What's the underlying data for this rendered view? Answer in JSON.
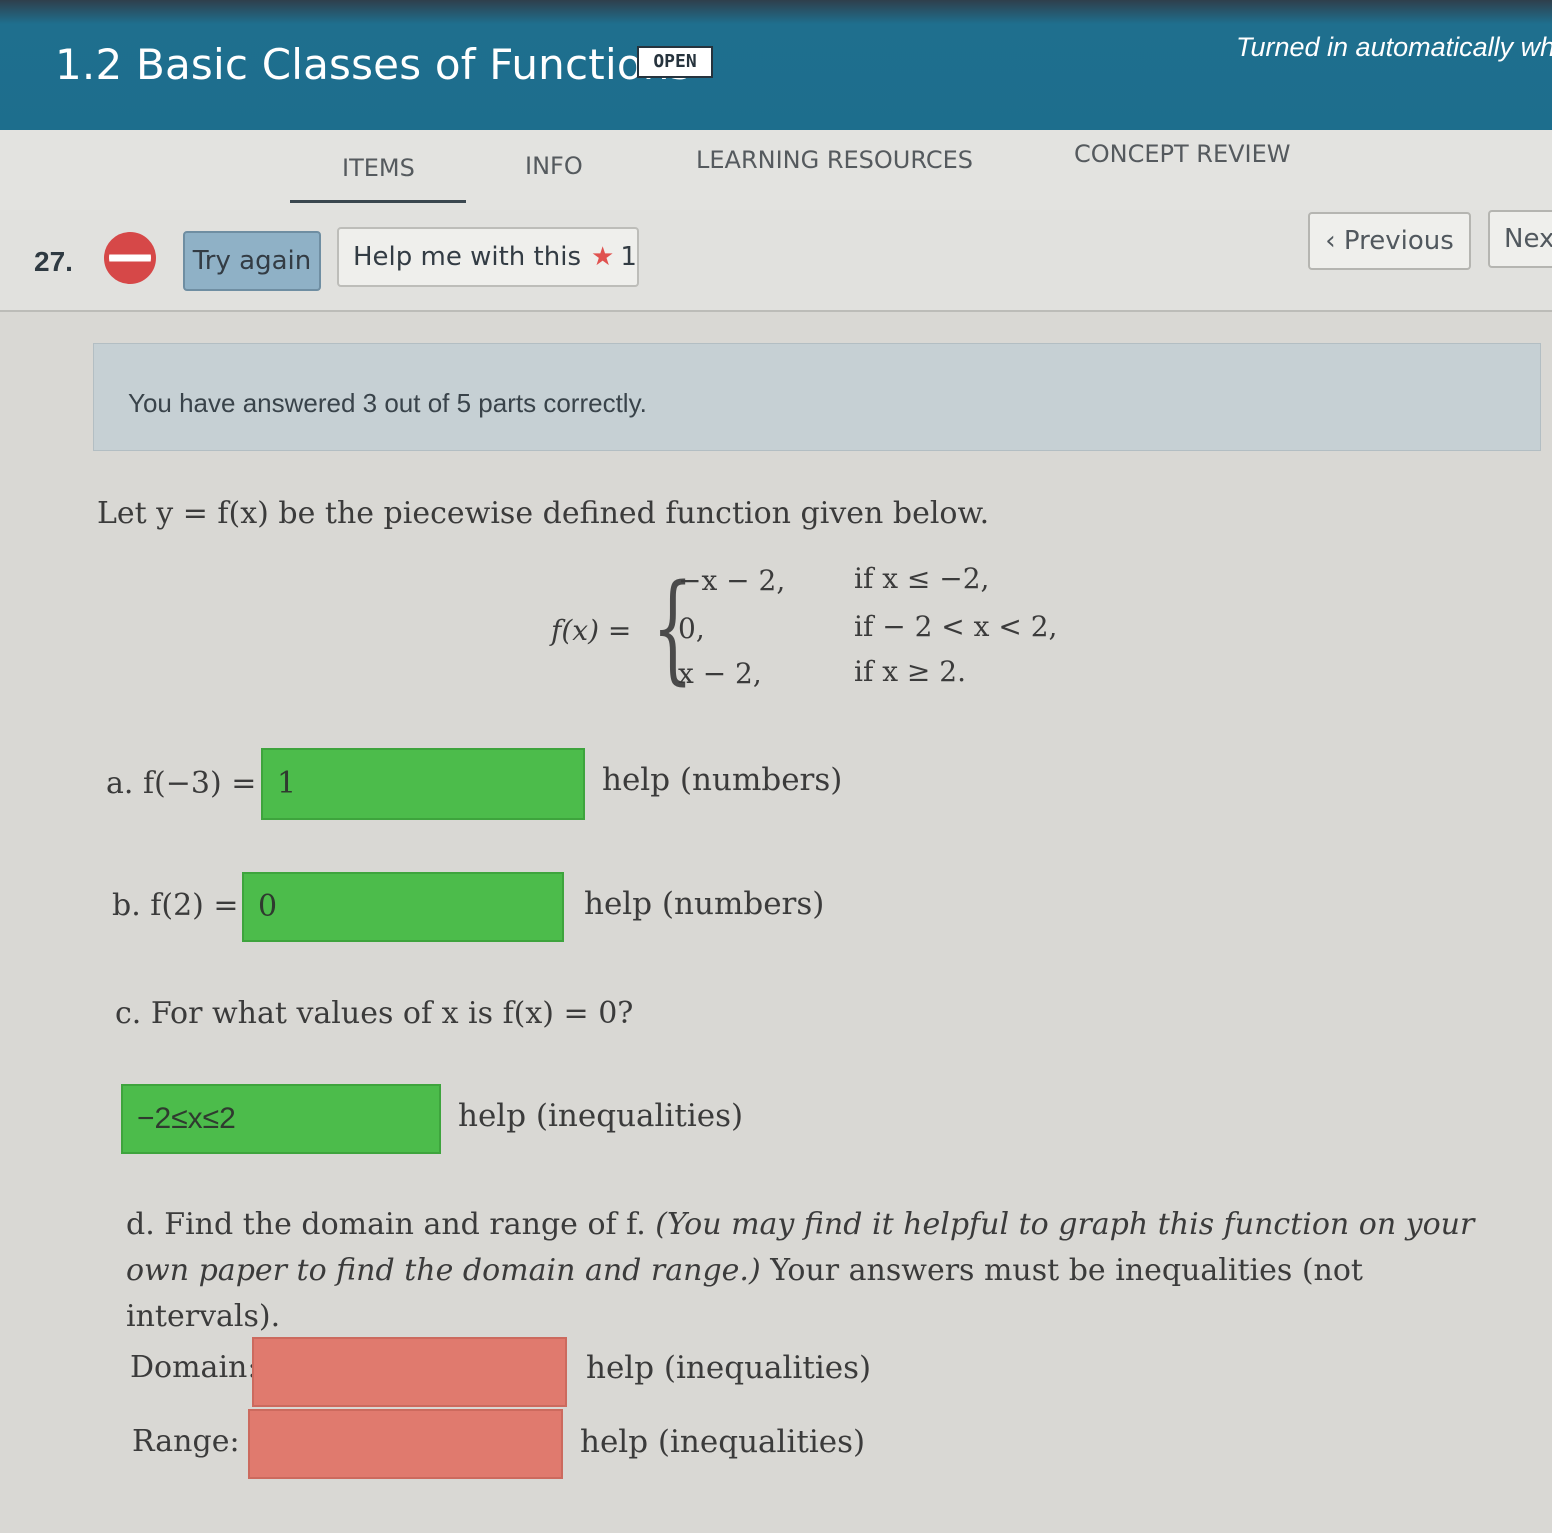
{
  "header": {
    "title": "1.2 Basic Classes of Functions",
    "badge": "OPEN",
    "turned_in": "Turned in automatically wher"
  },
  "tabs": [
    {
      "label": "ITEMS",
      "active": true
    },
    {
      "label": "INFO"
    },
    {
      "label": "LEARNING RESOURCES"
    },
    {
      "label": "CONCEPT REVIEW"
    }
  ],
  "question": {
    "number": "27.",
    "try_again": "Try again",
    "help_me": "Help me with this",
    "help_count": "1",
    "previous": "Previous",
    "next": "Nex"
  },
  "banner": "You have answered 3 out of 5 parts correctly.",
  "problem": {
    "intro": "Let y = f(x) be the piecewise defined function given below.",
    "fx_lhs": "f(x) =",
    "cases": [
      {
        "expr": "−x − 2,",
        "cond": "if x ≤ −2,"
      },
      {
        "expr": "0,",
        "cond": "if − 2 < x < 2,"
      },
      {
        "expr": "x − 2,",
        "cond": "if x ≥ 2."
      }
    ]
  },
  "parts": {
    "a": {
      "label": "a. f(−3) =",
      "value": "1",
      "help": "help (numbers)"
    },
    "b": {
      "label": "b. f(2) =",
      "value": "0",
      "help": "help (numbers)"
    },
    "c": {
      "question": "c. For what values of x is f(x) = 0?",
      "value": "−2≤x≤2",
      "help": "help (inequalities)"
    },
    "d": {
      "question_start": "d. Find the domain and range of f. ",
      "question_italic": "(You may find it helpful to graph this function on your own paper to find the domain and range.)",
      "question_end": " Your answers must be inequalities (not intervals).",
      "domain_label": "Domain:",
      "domain_value": "",
      "range_label": "Range:",
      "range_value": "",
      "help": "help (inequalities)"
    }
  },
  "colors": {
    "correct": "#4cbc4b",
    "incorrect": "#e07a6e",
    "header": "#1d6e8d"
  }
}
